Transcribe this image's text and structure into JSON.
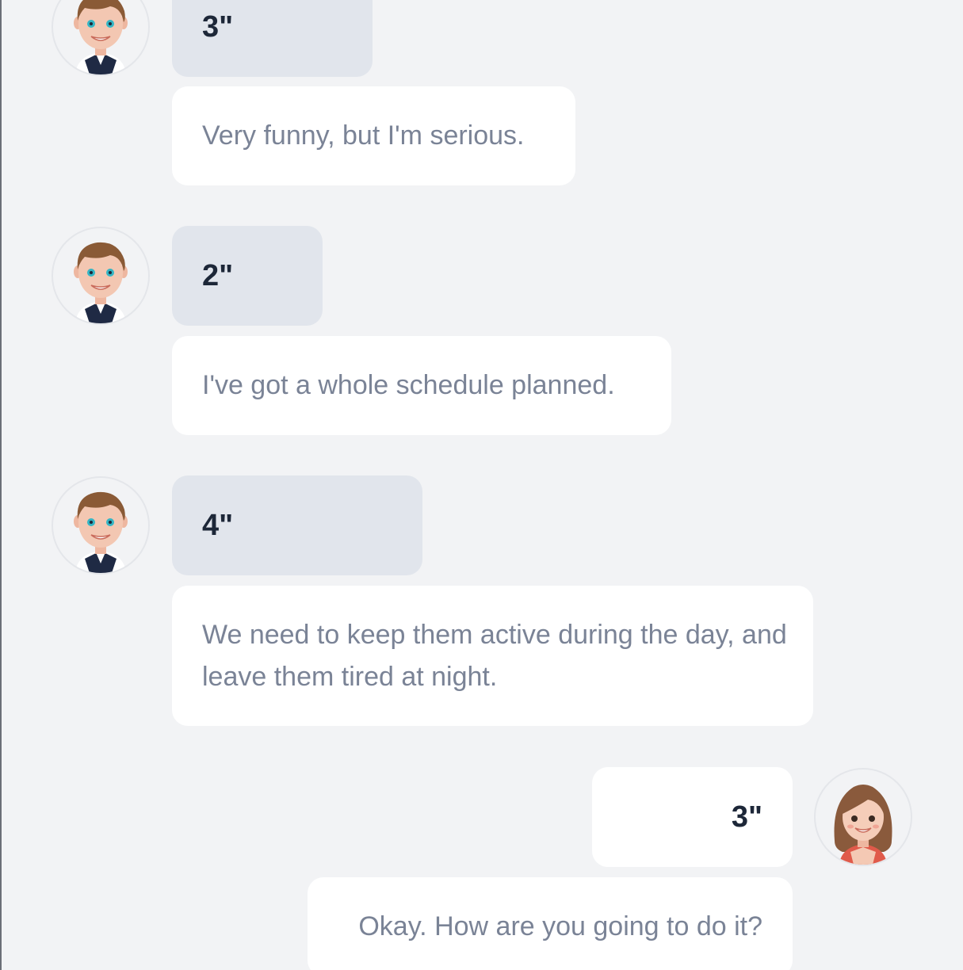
{
  "colors": {
    "background": "#f2f3f5",
    "duration_bubble": "#e1e5ec",
    "text_bubble": "#ffffff",
    "duration_text": "#1d2738",
    "message_text": "#7a8396"
  },
  "messages": [
    {
      "speaker": "male",
      "side": "left",
      "duration": "3\"",
      "text": "Very funny, but I'm serious."
    },
    {
      "speaker": "male",
      "side": "left",
      "duration": "2\"",
      "text": "I've got a whole schedule planned."
    },
    {
      "speaker": "male",
      "side": "left",
      "duration": "4\"",
      "text": "We need to keep them active during the day, and leave them tired at night."
    },
    {
      "speaker": "female",
      "side": "right",
      "duration": "3\"",
      "text": "Okay. How are you going to do it?"
    }
  ],
  "icons": {
    "male_avatar": "man-avatar-icon",
    "female_avatar": "woman-avatar-icon"
  }
}
